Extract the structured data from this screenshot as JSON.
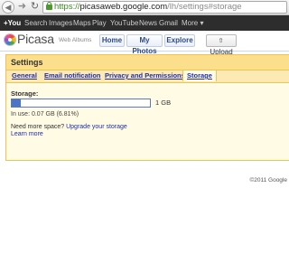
{
  "browser": {
    "url_scheme": "https://",
    "url_host": "picasaweb.google.com",
    "url_path": "/lh/settings#storage"
  },
  "gbar": {
    "items": [
      "+You",
      "Search",
      "Images",
      "Maps",
      "Play",
      "YouTube",
      "News",
      "Gmail",
      "More ▾"
    ]
  },
  "header": {
    "logo_word": "Picasa",
    "logo_sub": "Web Albums",
    "nav": [
      "Home",
      "My Photos",
      "Explore"
    ],
    "upload_label": "Upload"
  },
  "settings": {
    "title": "Settings",
    "tabs": [
      "General",
      "Email notification",
      "Privacy and Permissions",
      "Storage"
    ],
    "active_tab": "Storage",
    "storage_label": "Storage:",
    "usage_fraction": 0.0681,
    "total": "1 GB",
    "in_use": "In use:  0.07 GB (6.81%)",
    "need_more_text": "Need more space?",
    "upgrade_link": "Upgrade your storage",
    "learn_more": "Learn more"
  },
  "footer": {
    "copyright": "©2011 Google"
  },
  "colors": {
    "panel_head": "#fcdf8c",
    "panel_body": "#fffbe4",
    "panel_border": "#f2c34e",
    "link": "#1f2fa8",
    "bar_fill": "#4a74c7"
  }
}
